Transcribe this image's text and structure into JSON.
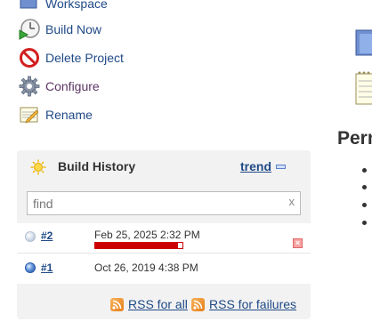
{
  "tasks": [
    {
      "label": "Workspace",
      "icon": "folder-icon",
      "visited": false
    },
    {
      "label": "Build Now",
      "icon": "build-clock-icon",
      "visited": false
    },
    {
      "label": "Delete Project",
      "icon": "no-entry-icon",
      "visited": false
    },
    {
      "label": "Configure",
      "icon": "gear-icon",
      "visited": true
    },
    {
      "label": "Rename",
      "icon": "notepad-pencil-icon",
      "visited": false
    }
  ],
  "build_history": {
    "title": "Build History",
    "trend_label": "trend",
    "search": {
      "placeholder": "find",
      "value": "",
      "clear_label": "x"
    },
    "builds": [
      {
        "number": "#2",
        "date": "Feb 25, 2025 2:32 PM",
        "status": "in-progress",
        "progress": 0.95
      },
      {
        "number": "#1",
        "date": "Oct 26, 2019 4:38 PM",
        "status": "success"
      }
    ],
    "rss_all_label": "RSS for all",
    "rss_failures_label": "RSS for failures"
  },
  "right_panel": {
    "heading": "Perm"
  },
  "colors": {
    "link": "#204a87",
    "visited_link": "#5c3566",
    "widget_bg": "#f2f2f2",
    "progress_red": "#cc0000"
  }
}
